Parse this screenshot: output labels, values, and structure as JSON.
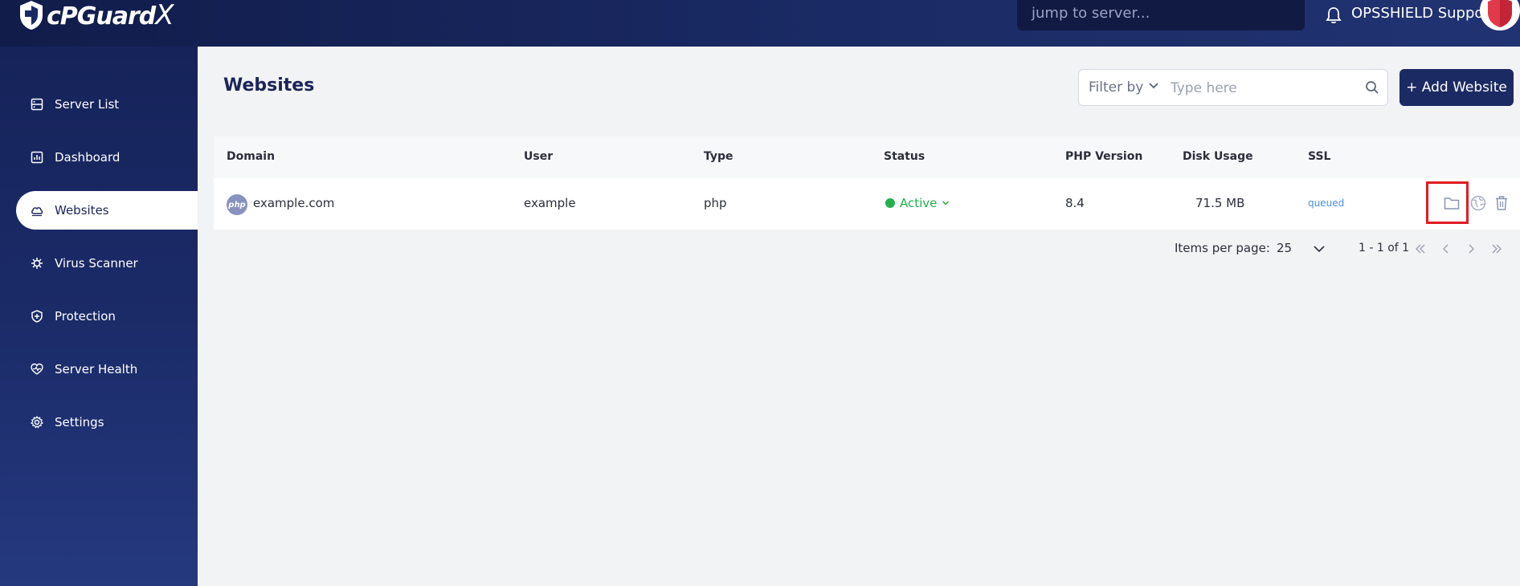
{
  "app": {
    "logo_text": "cPGuard",
    "logo_suffix": "X",
    "jump_placeholder": "jump to server...",
    "user_name": "OPSSHIELD Support"
  },
  "sidebar": {
    "items": [
      {
        "label": "Server List",
        "icon": "server-icon",
        "active": false
      },
      {
        "label": "Dashboard",
        "icon": "chart-icon",
        "active": false
      },
      {
        "label": "Websites",
        "icon": "cloud-icon",
        "active": true
      },
      {
        "label": "Virus Scanner",
        "icon": "virus-icon",
        "active": false
      },
      {
        "label": "Protection",
        "icon": "shield-icon",
        "active": false
      },
      {
        "label": "Server Health",
        "icon": "heart-pulse-icon",
        "active": false
      },
      {
        "label": "Settings",
        "icon": "gear-icon",
        "active": false
      }
    ]
  },
  "main": {
    "title": "Websites",
    "filter": {
      "label": "Filter by",
      "placeholder": "Type here"
    },
    "add_button": "+ Add Website",
    "table": {
      "columns": [
        "Domain",
        "User",
        "Type",
        "Status",
        "PHP Version",
        "Disk Usage",
        "SSL"
      ],
      "rows": [
        {
          "domain": "example.com",
          "domain_icon_text": "php",
          "user": "example",
          "type": "php",
          "status": "Active",
          "php_version": "8.4",
          "disk_usage": "71.5 MB",
          "ssl": "queued",
          "actions": [
            "folder-icon",
            "globe-icon",
            "trash-icon"
          ]
        }
      ]
    },
    "pagination": {
      "items_per_page_label": "Items per page:",
      "items_per_page": "25",
      "range": "1 - 1 of 1"
    }
  },
  "colors": {
    "nav_dark": "#16235a",
    "accent": "#1c2a63",
    "status_active": "#22b14c",
    "ssl_queued": "#4a8ee0",
    "highlight": "#e01b24"
  }
}
